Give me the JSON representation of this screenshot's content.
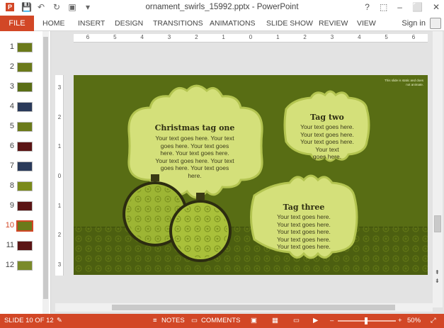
{
  "window": {
    "title": "ornament_swirls_15992.pptx - PowerPoint",
    "controls": [
      "?",
      "⬚",
      "–",
      "⬜",
      "✕"
    ]
  },
  "quick_access": [
    "save-icon",
    "undo-icon",
    "redo-icon",
    "present-icon"
  ],
  "ribbon": {
    "file_tab": "FILE",
    "tabs": [
      "HOME",
      "INSERT",
      "DESIGN",
      "TRANSITIONS",
      "ANIMATIONS",
      "SLIDE SHOW",
      "REVIEW",
      "VIEW"
    ],
    "sign_in": "Sign in"
  },
  "ruler": {
    "horizontal": [
      "6",
      "5",
      "4",
      "3",
      "2",
      "1",
      "0",
      "1",
      "2",
      "3",
      "4",
      "5",
      "6"
    ],
    "vertical": [
      "3",
      "2",
      "1",
      "0",
      "1",
      "2",
      "3"
    ]
  },
  "thumbnails": [
    {
      "num": "1",
      "color": "#6b7a1a"
    },
    {
      "num": "2",
      "color": "#6b7a1a"
    },
    {
      "num": "3",
      "color": "#5a6e15"
    },
    {
      "num": "4",
      "color": "#2a3a5a"
    },
    {
      "num": "5",
      "color": "#6b7a1a"
    },
    {
      "num": "6",
      "color": "#5a1414"
    },
    {
      "num": "7",
      "color": "#2a3a5a"
    },
    {
      "num": "8",
      "color": "#7a8a1a"
    },
    {
      "num": "9",
      "color": "#5a1414"
    },
    {
      "num": "10",
      "color": "#6b7a1a"
    },
    {
      "num": "11",
      "color": "#5a1414"
    },
    {
      "num": "12",
      "color": "#7a8a2a"
    }
  ],
  "active_slide": "10",
  "slide": {
    "note": "This slide is static and does not animate.",
    "tag_one": {
      "title": "Christmas tag one",
      "lines": [
        "Your text goes here. Your text",
        "goes here. Your text goes",
        "here. Your text goes here.",
        "Your text goes here. Your text",
        "goes here. Your text goes",
        "here."
      ]
    },
    "tag_two": {
      "title": "Tag two",
      "lines": [
        "Your text goes here.",
        "Your text goes here.",
        "Your text goes here.",
        "Your text",
        "goes here."
      ]
    },
    "tag_three": {
      "title": "Tag three",
      "lines": [
        "Your text goes here.",
        "Your text goes here.",
        "Your text goes here.",
        "Your text goes here.",
        "Your text goes here."
      ]
    },
    "colors": {
      "background": "#586d14",
      "tag": "#d4e07a",
      "tag_border": "#c2d064"
    }
  },
  "status": {
    "slide": "SLIDE 10 OF 12",
    "notes": "NOTES",
    "comments": "COMMENTS",
    "zoom": "50%"
  }
}
